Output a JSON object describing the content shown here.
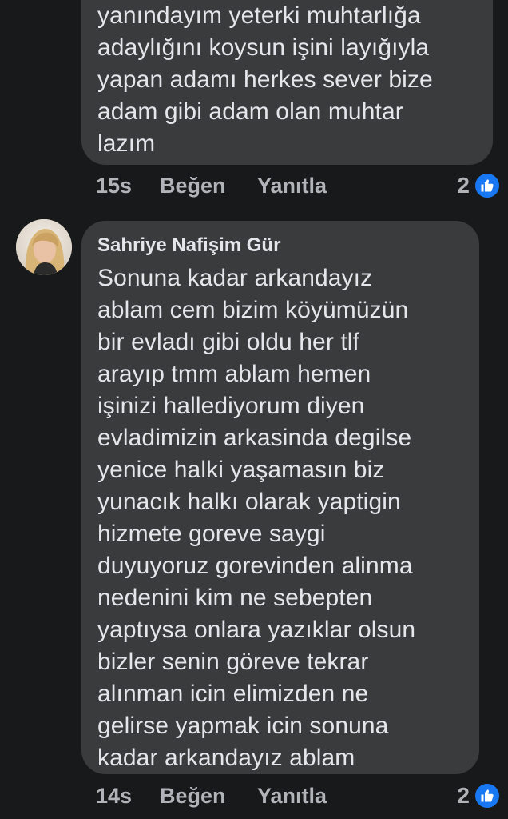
{
  "comments": [
    {
      "text": "yanındayım yeterki muhtarlığa\nadaylığını koysun işini layığıyla\nyapan adamı herkes sever bize\nadam gibi adam olan muhtar\nlazım",
      "time": "15s",
      "like_label": "Beğen",
      "reply_label": "Yanıtla",
      "reaction_count": "2",
      "reaction_icon": "like-icon"
    },
    {
      "author": "Sahriye Nafişim Gür",
      "avatar_icon": "profile-photo",
      "text": "Sonuna kadar arkandayız\nablam cem bizim köyümüzün\nbir evladı gibi oldu her tlf\narayıp tmm ablam hemen\nişinizi hallediyorum diyen\nevladimizin arkasinda degilse\nyenice halki yaşamasın biz\nyunacık halkı olarak yaptigin\nhizmete goreve saygi\nduyuyoruz gorevinden alinma\nnedenini kim ne sebepten\nyaptıysa onlara yazıklar olsun\nbizler senin göreve tekrar\nalınman icin elimizden ne\ngelirse yapmak icin sonuna\nkadar arkandayız ablam",
      "time": "14s",
      "like_label": "Beğen",
      "reply_label": "Yanıtla",
      "reaction_count": "2",
      "reaction_icon": "like-icon"
    }
  ],
  "colors": {
    "background": "#18191a",
    "bubble": "#3a3b3c",
    "text": "#e4e6eb",
    "secondary_text": "#b0b3b8",
    "like_blue": "#1877f2"
  }
}
